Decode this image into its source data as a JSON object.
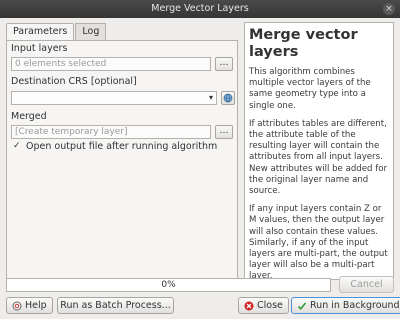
{
  "window": {
    "title": "Merge Vector Layers",
    "close_glyph": "×"
  },
  "tabs": [
    {
      "label": "Parameters",
      "active": true
    },
    {
      "label": "Log",
      "active": false
    }
  ],
  "params": {
    "input_layers_label": "Input layers",
    "input_layers_value": "0 elements selected",
    "browse_glyph": "…",
    "crs_label": "Destination CRS [optional]",
    "crs_value": "",
    "merged_label": "Merged",
    "merged_placeholder": "[Create temporary layer]",
    "open_output_label": "Open output file after running algorithm",
    "open_output_checked": true
  },
  "help": {
    "title": "Merge vector layers",
    "paragraphs": [
      "This algorithm combines multiple vector layers of the same geometry type into a single one.",
      "If attributes tables are different, the attribute table of the resulting layer will contain the attributes from all input layers. New attributes will be added for the original layer name and source.",
      "If any input layers contain Z or M values, then the output layer will also contain these values. Similarly, if any of the input layers are multi-part, the output layer will also be a multi-part layer."
    ]
  },
  "progress": {
    "value": 0,
    "text": "0%"
  },
  "buttons": {
    "cancel": "Cancel",
    "help": "Help",
    "batch": "Run as Batch Process...",
    "close": "Close",
    "run": "Run in Background"
  },
  "colors": {
    "accent": "#4a90d9",
    "close_red": "#cc2222",
    "run_green": "#2e9e3e"
  }
}
